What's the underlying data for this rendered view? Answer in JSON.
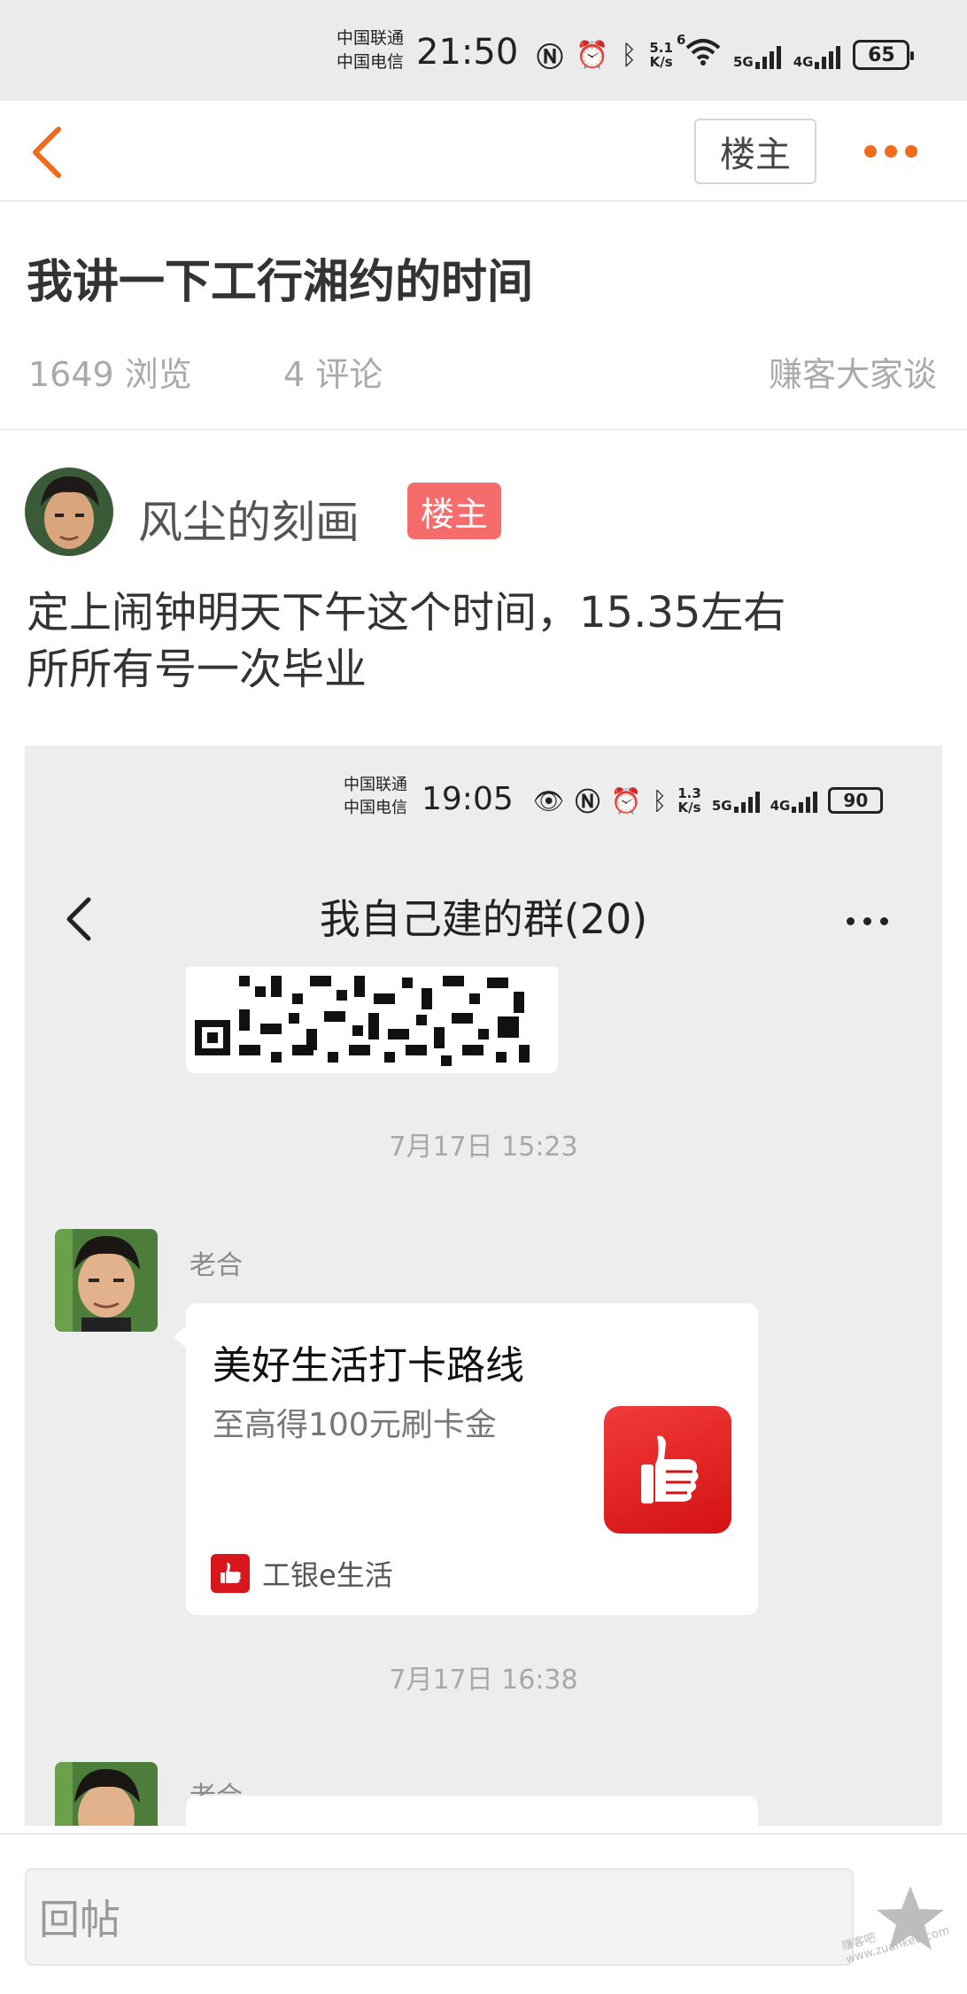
{
  "status_bar": {
    "carrier_1": "中国联通",
    "carrier_2": "中国电信",
    "time": "21:50",
    "net_speed_value": "5.1",
    "net_speed_unit": "K/s",
    "wifi_label": "6",
    "signal_1_label": "5G",
    "signal_2_label": "4G",
    "battery": "65"
  },
  "nav": {
    "owner_only_button": "楼主"
  },
  "post": {
    "title": "我讲一下工行湘约的时间",
    "views": "1649 浏览",
    "comments": "4 评论",
    "category": "赚客大家谈",
    "author_name": "风尘的刻画",
    "author_badge": "楼主",
    "body_line_1": "定上闹钟明天下午这个时间，15.35左右",
    "body_line_2": "所所有号一次毕业"
  },
  "embedded_screenshot": {
    "carrier_1": "中国联通",
    "carrier_2": "中国电信",
    "time": "19:05",
    "net_speed_value": "1.3",
    "net_speed_unit": "K/s",
    "signal_1_label": "5G",
    "signal_2_label": "4G",
    "battery": "90",
    "group_title": "我自己建的群(20)",
    "timestamp_1": "7月17日 15:23",
    "sender_1": "老合",
    "card_title": "美好生活打卡路线",
    "card_subtitle": "至高得100元刷卡金",
    "card_source": "工银e生活",
    "timestamp_2": "7月17日 16:38",
    "sender_2": "老合"
  },
  "reply_bar": {
    "placeholder": "回帖",
    "watermark": "赚客吧 www.zuanke8.com"
  },
  "colors": {
    "accent_orange": "#f26b1d",
    "owner_badge_red": "#f66b6b",
    "muted_text": "#aaaaaa",
    "icbc_red": "#d9161c"
  }
}
